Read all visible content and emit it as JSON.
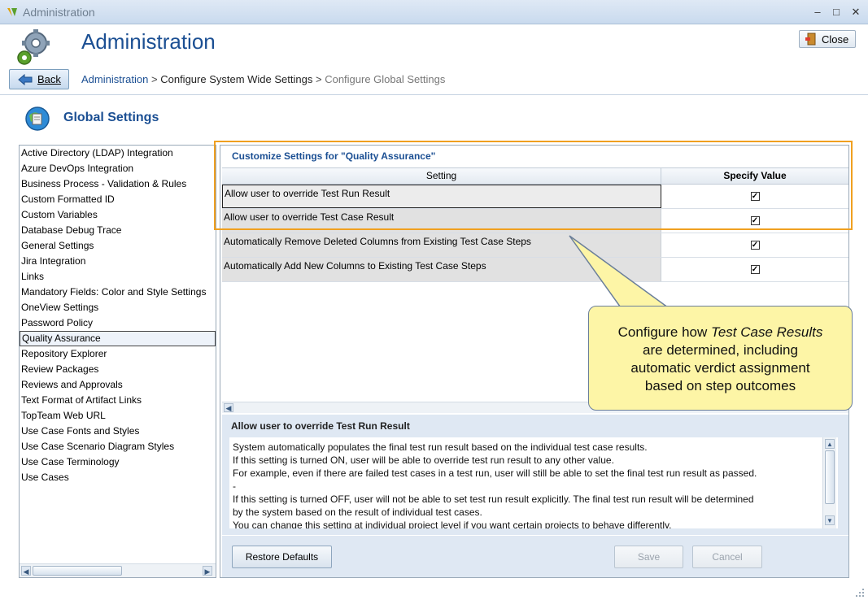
{
  "window": {
    "title": "Administration",
    "controls": [
      "–",
      "□",
      "✕"
    ]
  },
  "header": {
    "title": "Administration",
    "close_label": "Close",
    "back_label": "Back"
  },
  "breadcrumb": {
    "root": "Administration",
    "middle": "Configure System Wide Settings",
    "current": "Configure Global Settings",
    "sep": ">"
  },
  "section": {
    "title": "Global Settings"
  },
  "sidebar": {
    "items": [
      {
        "label": "Active Directory (LDAP) Integration"
      },
      {
        "label": "Azure DevOps Integration"
      },
      {
        "label": "Business Process - Validation & Rules"
      },
      {
        "label": "Custom Formatted ID"
      },
      {
        "label": "Custom Variables"
      },
      {
        "label": "Database Debug Trace"
      },
      {
        "label": "General Settings"
      },
      {
        "label": "Jira Integration"
      },
      {
        "label": "Links"
      },
      {
        "label": "Mandatory Fields: Color and Style Settings"
      },
      {
        "label": "OneView Settings"
      },
      {
        "label": "Password Policy"
      },
      {
        "label": "Quality Assurance",
        "selected": true
      },
      {
        "label": "Repository Explorer"
      },
      {
        "label": "Review Packages"
      },
      {
        "label": "Reviews and Approvals"
      },
      {
        "label": "Text Format of Artifact Links"
      },
      {
        "label": "TopTeam Web URL"
      },
      {
        "label": "Use Case Fonts and Styles"
      },
      {
        "label": "Use Case Scenario Diagram Styles"
      },
      {
        "label": "Use Case Terminology"
      },
      {
        "label": "Use Cases"
      }
    ]
  },
  "grid": {
    "title": "Customize Settings for \"Quality Assurance\"",
    "col_setting": "Setting",
    "col_value": "Specify Value",
    "rows": [
      {
        "label": "Allow user to override Test Run Result",
        "checked": true,
        "selected": true
      },
      {
        "label": "Allow user to override Test Case Result",
        "checked": true
      },
      {
        "label": "Automatically Remove Deleted Columns from Existing Test Case Steps",
        "checked": true
      },
      {
        "label": "Automatically Add New Columns to Existing Test Case Steps",
        "checked": true
      }
    ]
  },
  "description": {
    "title": "Allow user to override Test Run Result",
    "lines": [
      "System automatically populates the final test run result based on the individual test case results.",
      "If this setting is turned ON, user will be able to override test run result to any other value.",
      "For example, even if there are failed test cases in a test run, user will still be able to set the final test run result as passed.",
      "-",
      "If this setting is turned OFF, user will not be able to set test run result explicitly. The final test run result will be determined",
      "by the system based on the result of individual test cases.",
      "You can change this setting at individual project level if you want certain projects to behave differently."
    ]
  },
  "buttons": {
    "restore_defaults": "Restore Defaults",
    "save": "Save",
    "cancel": "Cancel"
  },
  "callout": {
    "line1_prefix": "Configure how ",
    "line1_em": "Test Case Results",
    "line2": "are determined, including",
    "line3": "automatic verdict assignment",
    "line4": "based on step outcomes"
  },
  "colors": {
    "accent": "#1b4f93",
    "highlight": "#f0a020",
    "callout_bg": "#fdf5a6"
  }
}
